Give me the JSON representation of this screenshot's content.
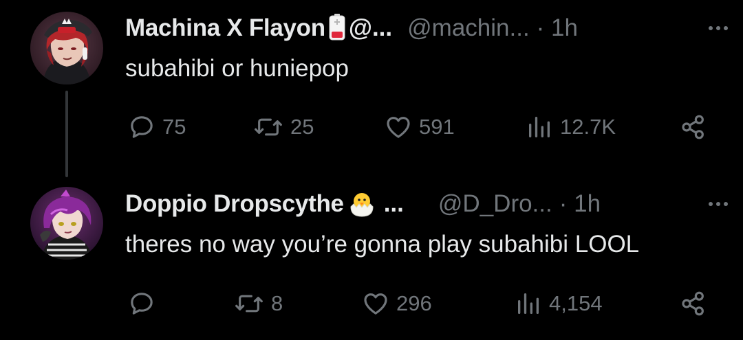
{
  "tweets": [
    {
      "display_name": "Machina X Flayon",
      "badge_icon": "battery-low-icon",
      "name_tail": "@...",
      "handle": "@machin...",
      "time": "· 1h",
      "text": "subahibi or huniepop",
      "stats": {
        "replies": "75",
        "reposts": "25",
        "likes": "591",
        "views": "12.7K"
      }
    },
    {
      "display_name": "Doppio Dropscythe",
      "badge_icon": "hatching-chick-icon",
      "name_tail": "...",
      "handle": "@D_Dro...",
      "time": "· 1h",
      "text": "theres no way you’re gonna play subahibi LOOL",
      "stats": {
        "replies": "",
        "reposts": "8",
        "likes": "296",
        "views": "4,154"
      }
    }
  ],
  "colors": {
    "background": "#000000",
    "primary_text": "#e7e9ea",
    "secondary_text": "#71767b",
    "thread_line": "#333639"
  }
}
